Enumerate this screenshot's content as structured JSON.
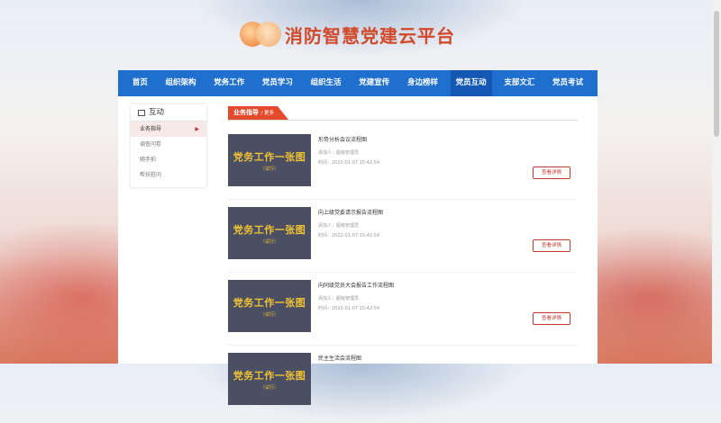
{
  "site": {
    "title": "消防智慧党建云平台"
  },
  "nav": {
    "items": [
      {
        "label": "首页",
        "active": false
      },
      {
        "label": "组织架构",
        "active": false
      },
      {
        "label": "党务工作",
        "active": false
      },
      {
        "label": "党员学习",
        "active": false
      },
      {
        "label": "组织生活",
        "active": false
      },
      {
        "label": "党建宣传",
        "active": false
      },
      {
        "label": "身边榜样",
        "active": false
      },
      {
        "label": "党员互动",
        "active": true
      },
      {
        "label": "支部文汇",
        "active": false
      },
      {
        "label": "党员考试",
        "active": false
      }
    ]
  },
  "sidebar": {
    "title": "互动",
    "items": [
      {
        "label": "业务指导",
        "active": true
      },
      {
        "label": "调查问卷",
        "active": false
      },
      {
        "label": "随手拍",
        "active": false
      },
      {
        "label": "帮扶慰问",
        "active": false
      }
    ]
  },
  "section": {
    "tab_label": "业务指导",
    "crumb": "/ 更多"
  },
  "posts": [
    {
      "thumb_title": "党务工作一张图",
      "thumb_sub": "（试行）",
      "title": "形势分析会议流程图",
      "author": "添加人：超级管理员",
      "time": "时间：2022-01-07 15:42:54",
      "button": "查看详情"
    },
    {
      "thumb_title": "党务工作一张图",
      "thumb_sub": "（试行）",
      "title": "向上级党委请示报告流程图",
      "author": "添加人：超级管理员",
      "time": "时间：2022-01-07 15:42:54",
      "button": "查看详情"
    },
    {
      "thumb_title": "党务工作一张图",
      "thumb_sub": "（试行）",
      "title": "向同级党员大会报告工作流程图",
      "author": "添加人：超级管理员",
      "time": "时间：2022-01-07 15:42:54",
      "button": "查看详情"
    },
    {
      "thumb_title": "党务工作一张图",
      "thumb_sub": "（试行）",
      "title": "民主生活会流程图",
      "author": "",
      "time": "",
      "button": ""
    }
  ]
}
